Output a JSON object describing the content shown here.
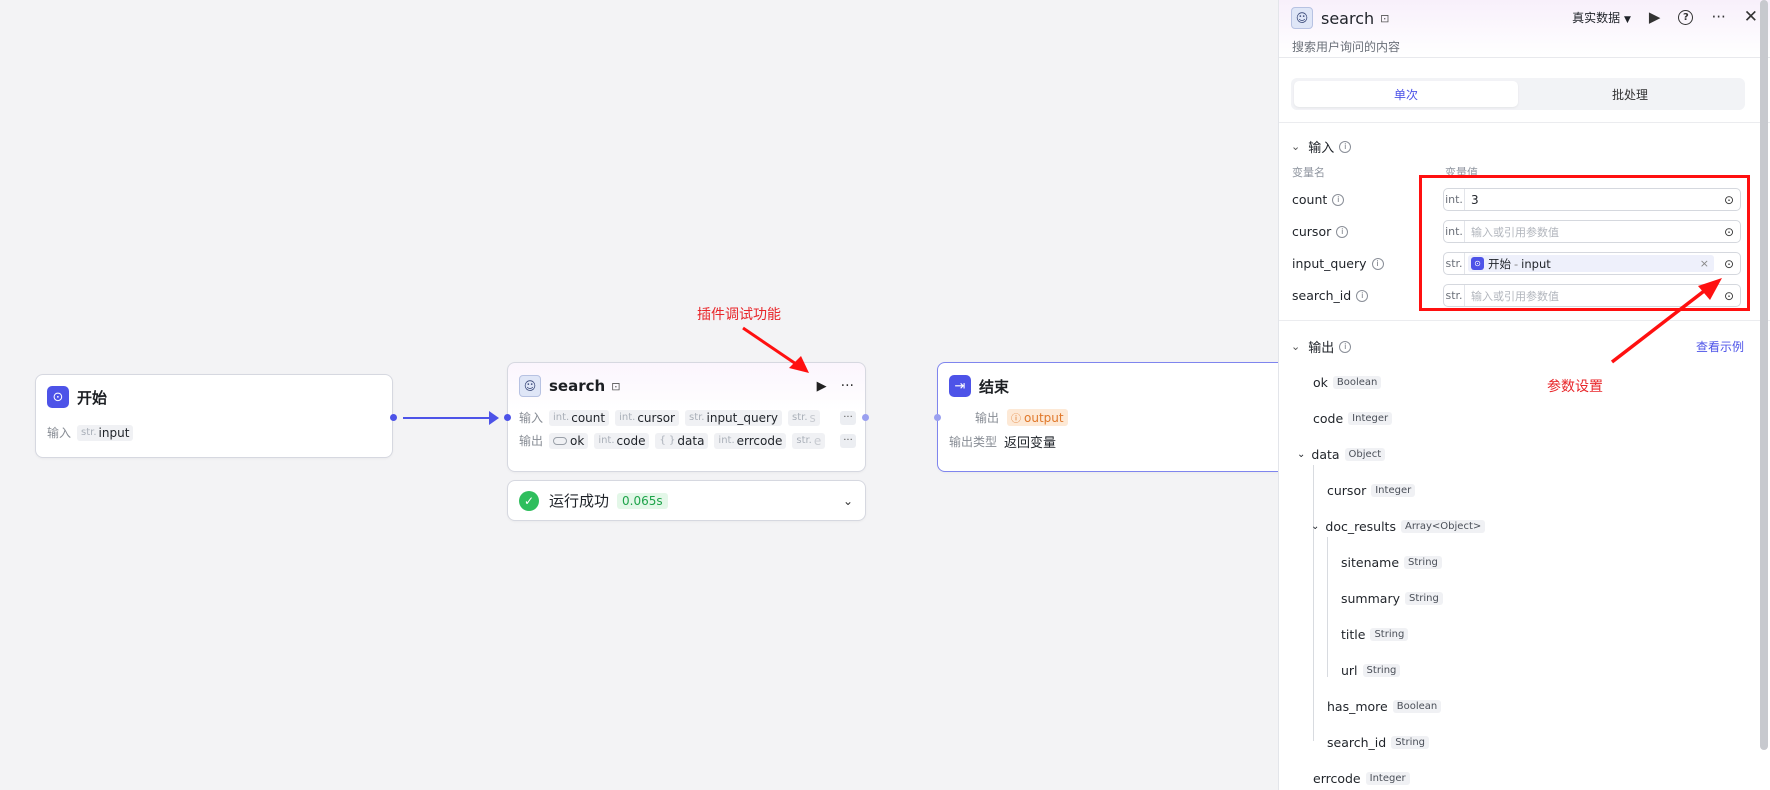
{
  "canvas": {
    "start_node": {
      "title": "开始",
      "input_label": "输入",
      "input_type": "str.",
      "input_name": "input"
    },
    "search_node": {
      "title": "search",
      "input_label": "输入",
      "output_label": "输出",
      "inputs": [
        {
          "type": "int.",
          "name": "count"
        },
        {
          "type": "int.",
          "name": "cursor"
        },
        {
          "type": "str.",
          "name": "input_query"
        },
        {
          "type": "str.",
          "name": "s"
        }
      ],
      "outputs": [
        {
          "type": "",
          "name": "ok"
        },
        {
          "type": "int.",
          "name": "code"
        },
        {
          "type": "{ }",
          "name": "data"
        },
        {
          "type": "int.",
          "name": "errcode"
        },
        {
          "type": "str.",
          "name": "e"
        }
      ],
      "more": "···",
      "run_status": "运行成功",
      "run_time": "0.065s"
    },
    "end_node": {
      "title": "结束",
      "output_label": "输出",
      "output_name": "output",
      "output_type_label": "输出类型",
      "output_type_value": "返回变量"
    },
    "annotations": {
      "plugin_debug": "插件调试功能",
      "param_settings": "参数设置"
    }
  },
  "panel": {
    "title": "search",
    "description": "搜索用户询问的内容",
    "data_mode": "真实数据",
    "tabs": [
      "单次",
      "批处理"
    ],
    "input_section": "输入",
    "col_name": "变量名",
    "col_value": "变量值",
    "params": [
      {
        "name": "count",
        "type": "int.",
        "value": "3",
        "placeholder": ""
      },
      {
        "name": "cursor",
        "type": "int.",
        "value": "",
        "placeholder": "输入或引用参数值"
      },
      {
        "name": "input_query",
        "type": "str.",
        "ref_node": "开始",
        "ref_var": "input"
      },
      {
        "name": "search_id",
        "type": "str.",
        "value": "",
        "placeholder": "输入或引用参数值"
      }
    ],
    "output_section": "输出",
    "view_example": "查看示例",
    "outputs": [
      {
        "name": "ok",
        "type": "Boolean"
      },
      {
        "name": "code",
        "type": "Integer"
      },
      {
        "name": "data",
        "type": "Object"
      },
      {
        "name": "cursor",
        "type": "Integer"
      },
      {
        "name": "doc_results",
        "type": "Array<Object>"
      },
      {
        "name": "sitename",
        "type": "String"
      },
      {
        "name": "summary",
        "type": "String"
      },
      {
        "name": "title",
        "type": "String"
      },
      {
        "name": "url",
        "type": "String"
      },
      {
        "name": "has_more",
        "type": "Boolean"
      },
      {
        "name": "search_id",
        "type": "String"
      },
      {
        "name": "errcode",
        "type": "Integer"
      }
    ]
  },
  "colors": {
    "accent": "#4d53e8",
    "annotation": "#e8262a",
    "success": "#2fbe5d"
  }
}
